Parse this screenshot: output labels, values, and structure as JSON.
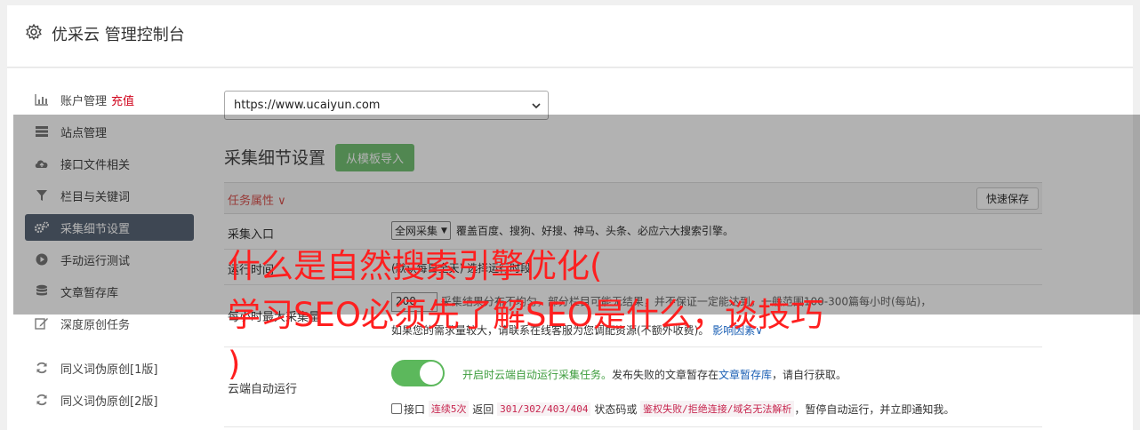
{
  "header": {
    "title": "优采云 管理控制台"
  },
  "sidebar": {
    "items": [
      {
        "label": "账户管理",
        "icon": "bar-chart-icon",
        "extra": "充值"
      },
      {
        "label": "站点管理",
        "icon": "server-icon"
      },
      {
        "label": "接口文件相关",
        "icon": "cloud-upload-icon"
      },
      {
        "label": "栏目与关键词",
        "icon": "filter-icon"
      },
      {
        "label": "采集细节设置",
        "icon": "cogs-icon",
        "active": true
      },
      {
        "label": "手动运行测试",
        "icon": "play-circle-icon"
      },
      {
        "label": "文章暂存库",
        "icon": "database-icon"
      },
      {
        "label": "深度原创任务",
        "icon": "edit-icon"
      },
      {
        "label": "同义词伪原创[1版]",
        "icon": "refresh-icon"
      },
      {
        "label": "同义词伪原创[2版]",
        "icon": "refresh-icon"
      }
    ]
  },
  "main": {
    "site_select": "https://www.ucaiyun.com",
    "section_title": "采集细节设置",
    "import_button": "从模板导入",
    "task_header": {
      "label": "任务属性",
      "quick_save": "快速保存"
    },
    "rows": {
      "entry": {
        "label": "采集入口",
        "select": "全网采集",
        "desc": "覆盖百度、搜狗、好搜、神马、头条、必应六大搜索引擎。"
      },
      "runtime": {
        "label": "运行时间",
        "desc": "(默认每日全天) 选择运行时段"
      },
      "max": {
        "label": "每小时最大采集量",
        "value": "200",
        "desc1": "采集结果分布不均匀，部分栏目可能无结果，并不保证一定能达到，一般范围100-300篇每小时(每站)，",
        "desc2": "如果您的需求量较大，请联系在线客服为您调配资源(不额外收费)。",
        "link": "影响因素"
      },
      "cloud": {
        "label": "云端自动运行",
        "status": "开启时云端自动运行采集任务。",
        "text1": "发布失败的文章暂存在",
        "link": "文章暂存库",
        "text2": "，请自行获取。",
        "cb_label": "接口",
        "code1": "连续5次",
        "t1": "返回",
        "code2": "301/302/403/404",
        "t2": "状态码或",
        "code3": "鉴权失败/拒绝连接/域名无法解析",
        "t3": "，暂停自动运行，并立即通知我。"
      }
    }
  },
  "overlay_title": {
    "line1": "什么是自然搜索引擎优化(",
    "line2": "学习SEO必须先了解SEO是什么，谈技巧",
    "line3": ")"
  },
  "colors": {
    "accent_green": "#5cb85c",
    "active_nav": "#5a6677",
    "title_red": "#ff1f1f",
    "danger": "#d9534f"
  }
}
